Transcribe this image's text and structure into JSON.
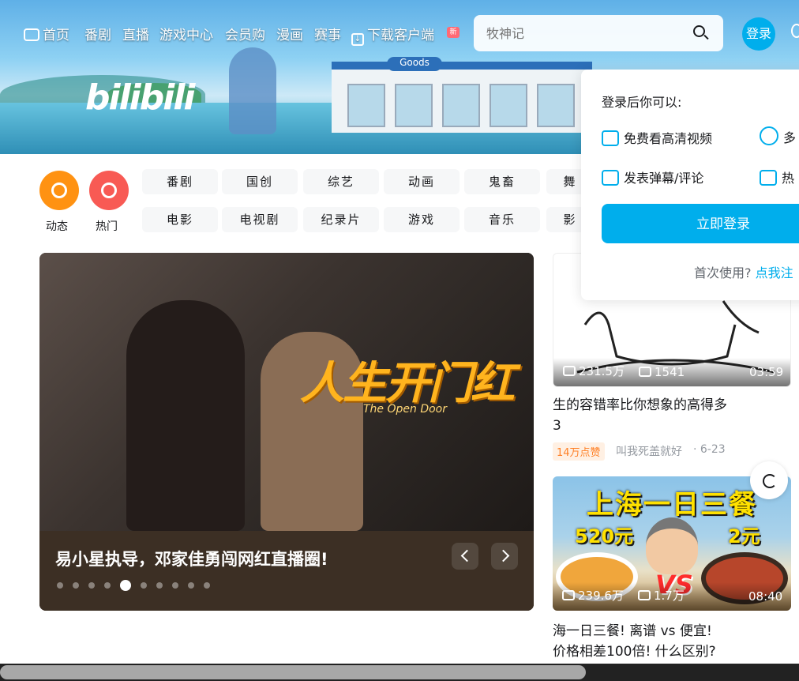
{
  "nav": {
    "home": "首页",
    "anime": "番剧",
    "live": "直播",
    "game_center": "游戏中心",
    "vip_shop": "会员购",
    "manga": "漫画",
    "esports": "赛事",
    "download": "下载客户端",
    "new_badge": "新"
  },
  "search": {
    "placeholder": "牧神记"
  },
  "login": {
    "label": "登录"
  },
  "logo": {
    "text": "bilibili"
  },
  "banner": {
    "store_sign": "Goods"
  },
  "popover": {
    "title": "登录后你可以:",
    "benefits": [
      "免费看高清视频",
      "多",
      "发表弹幕/评论",
      "热"
    ],
    "login_button": "立即登录",
    "first_use": "首次使用?",
    "first_use_link": "点我注"
  },
  "channels": {
    "dynamic": "动态",
    "hot": "热门",
    "chips": [
      "番剧",
      "国创",
      "综艺",
      "动画",
      "鬼畜",
      "舞",
      "电影",
      "电视剧",
      "纪录片",
      "游戏",
      "音乐",
      "影"
    ]
  },
  "carousel": {
    "poster_title": "人生开门红",
    "poster_subtitle": "The Open Door",
    "caption": "易小星执导，邓家佳勇闯网红直播圈!",
    "slide_count": 10,
    "active_index": 4
  },
  "cards": [
    {
      "views": "231.5万",
      "danmaku": "1541",
      "duration": "03:59",
      "title_line1": "生的容错率比你想象的高得多",
      "title_line2": "3",
      "hot_tag": "14万点赞",
      "up": "叫我死盖就好",
      "date": "· 6-23"
    },
    {
      "thumb_head": "上海一日三餐",
      "price_left": "520元",
      "price_right": "2元",
      "vs": "VS",
      "views": "239.6万",
      "danmaku": "1.7万",
      "duration": "08:40",
      "title_line1": "海一日三餐! 离谱 vs 便宜!",
      "title_line2": "价格相差100倍! 什么区别?"
    }
  ]
}
